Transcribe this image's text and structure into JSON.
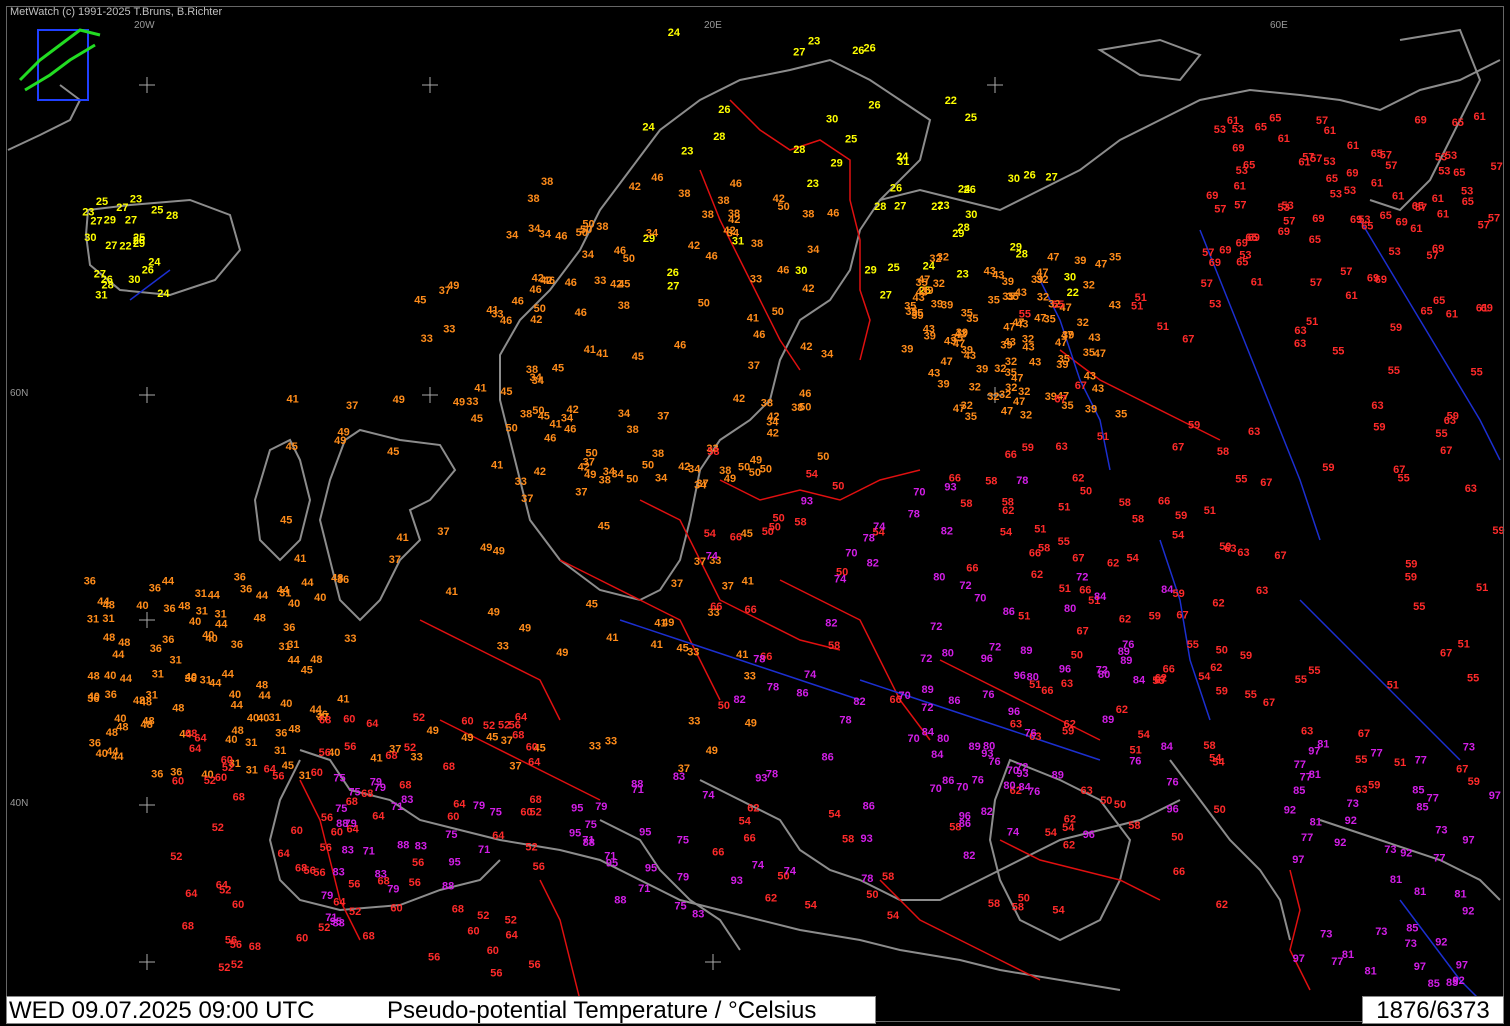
{
  "header": {
    "credit": "MetWatch  (c) 1991-2025 T.Bruns, B.Richter"
  },
  "footer": {
    "datetime": "WED 09.07.2025 09:00 UTC",
    "parameter": "Pseudo-potential Temperature / °Celsius",
    "counter": "1876/6373"
  },
  "grid_labels": {
    "lon_20w": "20W",
    "lon_20e": "20E",
    "lon_60e": "60E",
    "lat_60n": "60N",
    "lat_40n": "40N"
  },
  "colors": {
    "yellow": "#ffff00",
    "orange": "#ff8c1a",
    "red": "#ff2a2a",
    "magenta": "#d21ee6",
    "coast": "#8c8c8c",
    "border": "#e01010",
    "river": "#1c2fd0"
  },
  "observations": {
    "yellow": [
      "23",
      "27",
      "28",
      "26",
      "25",
      "24",
      "26",
      "27",
      "30",
      "29",
      "25",
      "22",
      "23",
      "28",
      "29",
      "26",
      "31",
      "24",
      "30",
      "27"
    ],
    "orange": [
      "33",
      "34",
      "35",
      "36",
      "37",
      "38",
      "39",
      "40",
      "41",
      "42",
      "43",
      "44",
      "45",
      "46",
      "47",
      "48",
      "49",
      "50",
      "32",
      "31"
    ],
    "red": [
      "50",
      "51",
      "52",
      "53",
      "54",
      "55",
      "56",
      "57",
      "58",
      "59",
      "60",
      "61",
      "62",
      "63",
      "64",
      "65",
      "66",
      "67",
      "68",
      "69"
    ],
    "magenta": [
      "70",
      "71",
      "72",
      "73",
      "74",
      "75",
      "76",
      "77",
      "78",
      "79",
      "80",
      "81",
      "82",
      "83",
      "84",
      "85",
      "86",
      "88",
      "89",
      "92",
      "93",
      "95",
      "96",
      "97"
    ]
  }
}
